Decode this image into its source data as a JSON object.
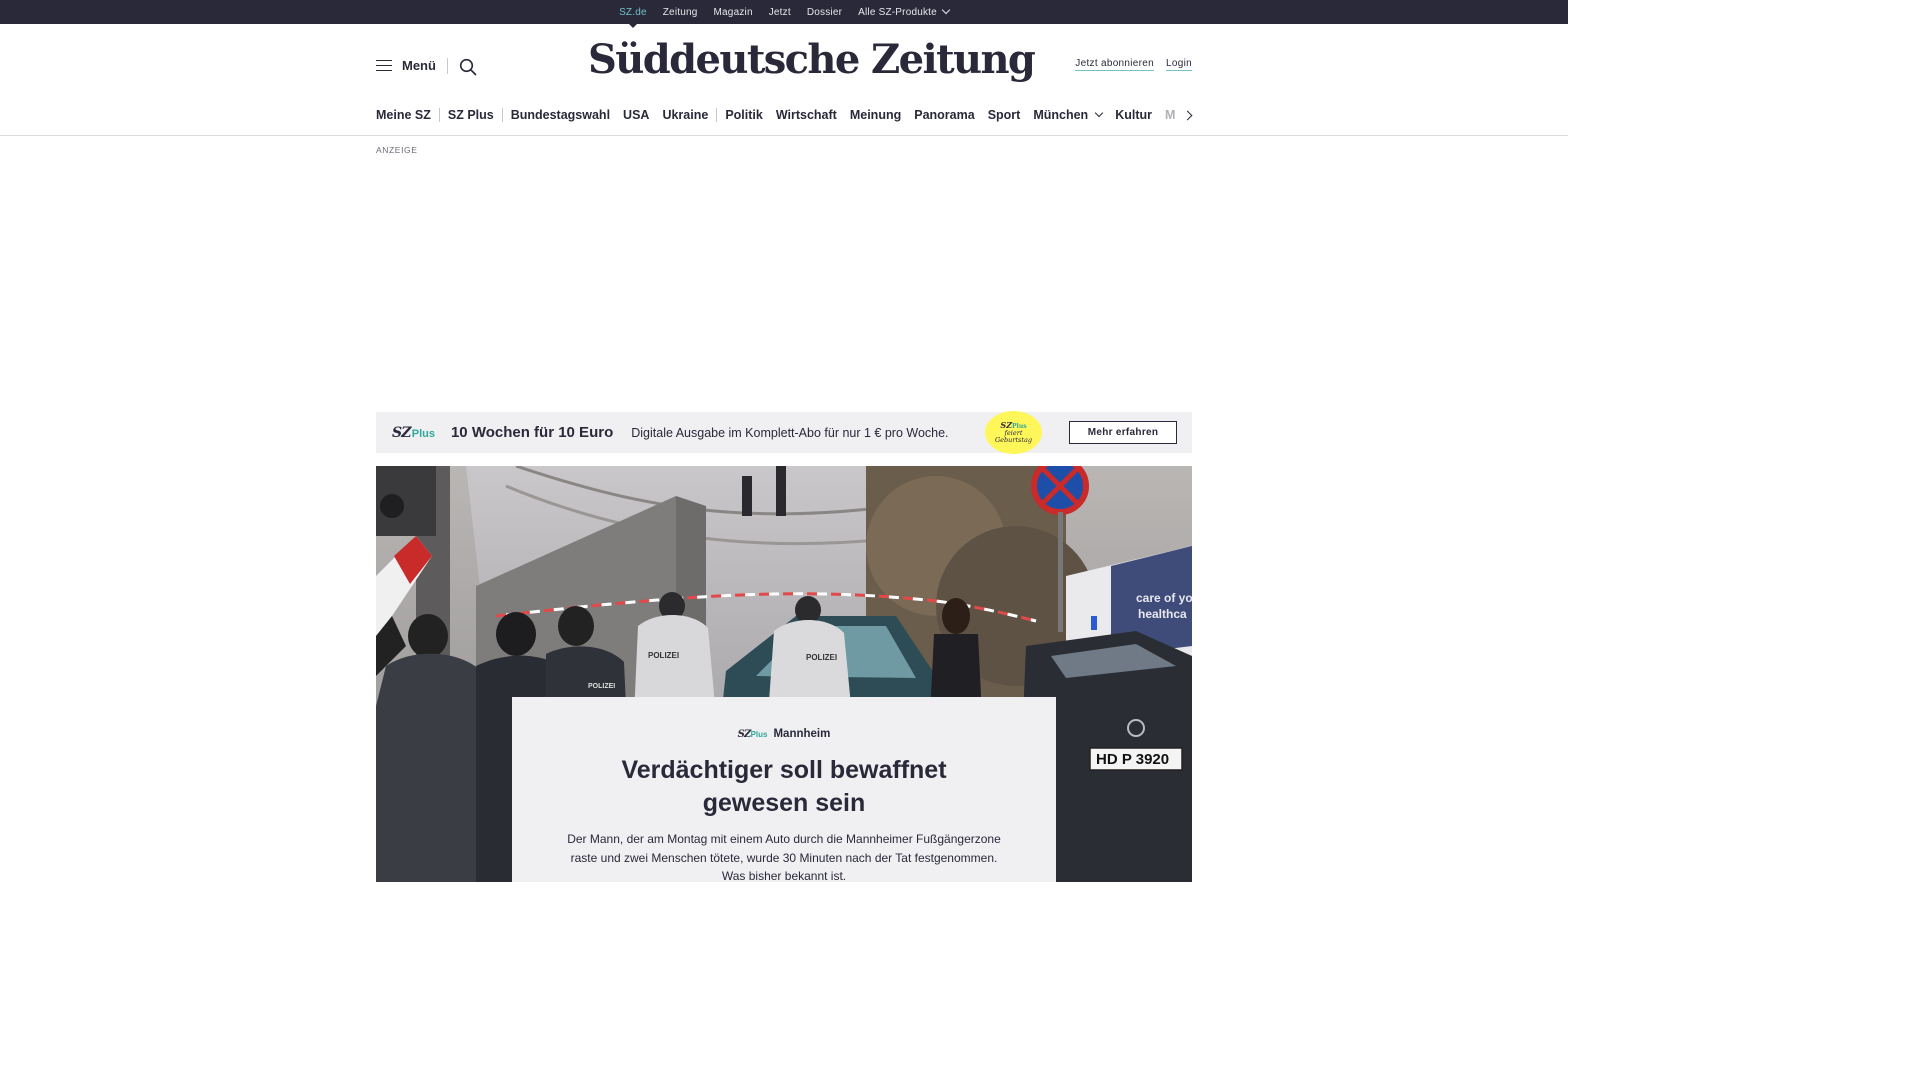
{
  "topbar": {
    "items": [
      {
        "label": "SZ.de",
        "active": true
      },
      {
        "label": "Zeitung"
      },
      {
        "label": "Magazin"
      },
      {
        "label": "Jetzt"
      },
      {
        "label": "Dossier"
      },
      {
        "label": "Alle SZ-Produkte",
        "dropdown": true
      }
    ]
  },
  "header": {
    "menu_label": "Menü",
    "logo_text": "Süddeutsche Zeitung",
    "subscribe_label": "Jetzt abonnieren",
    "login_label": "Login",
    "icons": [
      "hamburger-icon",
      "search-icon"
    ]
  },
  "nav": {
    "items": [
      "Meine SZ",
      "SZ Plus",
      "Bundestagswahl",
      "USA",
      "Ukraine",
      "Politik",
      "Wirtschaft",
      "Meinung",
      "Panorama",
      "Sport",
      "München",
      "Kultur",
      "M"
    ],
    "munich_dropdown": true
  },
  "ad": {
    "label": "ANZEIGE"
  },
  "promo": {
    "logo_sz": "SZ",
    "logo_plus": "Plus",
    "headline": "10 Wochen für 10 Euro",
    "subline": "Digitale Ausgabe im Komplett-Abo für nur 1 € pro Woche.",
    "badge_sz": "SZ",
    "badge_plus": "Plus",
    "badge_line1": "feiert",
    "badge_line2": "Geburtstag",
    "button_label": "Mehr erfahren",
    "badge_color": "#fff65a"
  },
  "hero": {
    "kicker_sz": "SZ",
    "kicker_plus": "Plus",
    "kicker": "Mannheim",
    "headline": "Verdächtiger soll bewaffnet gewesen sein",
    "teaser": "Der Mann, der am Montag mit einem Auto durch die Mannheimer Fußgängerzone raste und zwei Menschen tötete, wurde 30 Minuten nach der Tat festgenommen. Was bisher bekannt ist.",
    "photo_texts": {
      "police_vest_1": "POLIZEI",
      "police_vest_2": "POLIZEI",
      "police_vest_3": "POLIZEI",
      "van_text_1": "care of yo",
      "van_text_2": "healthca",
      "license_plate": "HD P 3920"
    }
  },
  "colors": {
    "brand_dark": "#29293a",
    "accent_teal": "#71c3c7",
    "plus_green": "#2ea89a",
    "panel_gray": "#f0f0f2"
  }
}
